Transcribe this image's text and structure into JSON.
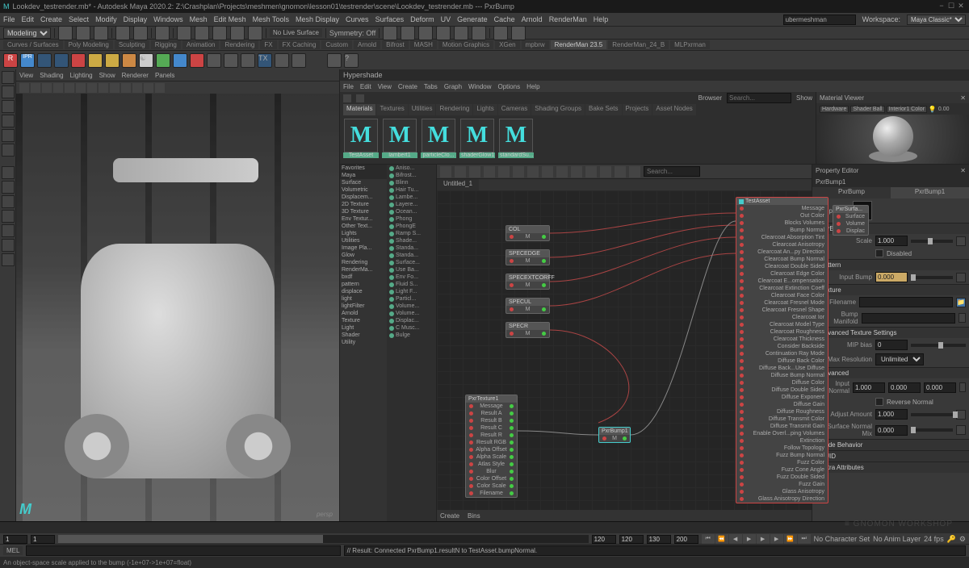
{
  "title": "Lookdev_testrender.mb* - Autodesk Maya 2020.2: Z:\\Crashplan\\Projects\\meshmen\\gnomon\\lesson01\\testrender\\scene\\Lookdev_testrender.mb --- PxrBump",
  "workspace_label": "Workspace:",
  "workspace_value": "Maya Classic*",
  "menus": [
    "File",
    "Edit",
    "Create",
    "Select",
    "Modify",
    "Display",
    "Windows",
    "Mesh",
    "Edit Mesh",
    "Mesh Tools",
    "Mesh Display",
    "Curves",
    "Surfaces",
    "Deform",
    "UV",
    "Generate",
    "Cache",
    "Arnold",
    "RenderMan",
    "Help"
  ],
  "sidebar_input": "ubermeshman",
  "shelf_mode": "Modeling",
  "shelf_nolive": "No Live Surface",
  "shelf_sym_label": "Symmetry: Off",
  "shelf_tabs": [
    "Curves / Surfaces",
    "Poly Modeling",
    "Sculpting",
    "Rigging",
    "Animation",
    "Rendering",
    "FX",
    "FX Caching",
    "Custom",
    "Arnold",
    "Bifrost",
    "MASH",
    "Motion Graphics",
    "XGen",
    "mpbrw",
    "RenderMan 23.5",
    "RenderMan_24_B",
    "MLPxrman"
  ],
  "viewport_menu": [
    "View",
    "Shading",
    "Lighting",
    "Show",
    "Renderer",
    "Panels"
  ],
  "viewport_label": "persp",
  "hypershade": {
    "title": "Hypershade",
    "menu": [
      "File",
      "Edit",
      "View",
      "Create",
      "Tabs",
      "Graph",
      "Window",
      "Options",
      "Help"
    ],
    "browser_label": "Browser",
    "show_label": "Show",
    "search_placeholder": "Search...",
    "tabs": [
      "Materials",
      "Textures",
      "Utilities",
      "Rendering",
      "Lights",
      "Cameras",
      "Shading Groups",
      "Bake Sets",
      "Projects",
      "Asset Nodes"
    ],
    "swatches": [
      {
        "letter": "M",
        "name": "TestAsset"
      },
      {
        "letter": "M",
        "name": "lambert1"
      },
      {
        "letter": "M",
        "name": "particleClo..."
      },
      {
        "letter": "M",
        "name": "shaderGlow1"
      },
      {
        "letter": "M",
        "name": "standardSu..."
      }
    ],
    "matviewer_title": "Material Viewer",
    "mv_hardware": "Hardware",
    "mv_shader": "Shader Ball",
    "mv_interior": "Interior1 Color",
    "create_title": "Create",
    "tree": [
      "Favorites",
      "Maya",
      "Surface",
      "Volumetric",
      "Displacem...",
      "2D Texture",
      "3D Texture",
      "Env Textur...",
      "Other Text...",
      "Lights",
      "Utilities",
      "Image Pla...",
      "Glow",
      "Rendering",
      "RenderMa...",
      "bxdf",
      "pattern",
      "displace",
      "light",
      "lightFilter",
      "Arnold",
      "Texture",
      "Light",
      "Shader",
      "Utility"
    ],
    "list": [
      "Aniso...",
      "Bifrost...",
      "Blinn",
      "Hair Tu...",
      "Lambe...",
      "Layere...",
      "Ocean...",
      "Phong",
      "PhongE",
      "Ramp S...",
      "Shade...",
      "Standa...",
      "Standa...",
      "Surface...",
      "Use Ba...",
      "Env Fo...",
      "Fluid S...",
      "Light F...",
      "Particl...",
      "Volume...",
      "Volume...",
      "Displac...",
      "C Musc...",
      "Bulge"
    ],
    "graph_tab": "Untitled_1",
    "graph_search": "Search...",
    "bins_label": "Bins"
  },
  "nodes": {
    "col": "COL",
    "specedge": "SPECEDGE",
    "specextcorff": "SPECEXTCORFF",
    "specul": "SPECUL",
    "specr": "SPECR",
    "pxrtex": "PxrTexture1",
    "pxrbump": "PxrBump1",
    "testasset": "TestAsset",
    "pxrsurf": "PxrSurfa...",
    "tex_rows": [
      "Message",
      "Result A",
      "Result B",
      "Result C",
      "Result R",
      "Result RGB",
      "Alpha Offset",
      "Alpha Scale",
      "Atlas Style",
      "Blur",
      "Color Offset",
      "Color Scale",
      "Filename"
    ],
    "asset_rows": [
      "Message",
      "Out Color",
      "Blocks Volumes",
      "Bump Normal",
      "Clearcoat Absorption Tint",
      "Clearcoat Anisotropy",
      "Clearcoat An...py Direction",
      "Clearcoat Bump Normal",
      "Clearcoat Double Sided",
      "Clearcoat Edge Color",
      "Clearcoat E...ompensation",
      "Clearcoat Extinction Coeff",
      "Clearcoat Face Color",
      "Clearcoat Fresnel Mode",
      "Clearcoat Fresnel Shape",
      "Clearcoat Ior",
      "Clearcoat Model Type",
      "Clearcoat Roughness",
      "Clearcoat Thickness",
      "Consider Backside",
      "Continuation Ray Mode",
      "Diffuse Back Color",
      "Diffuse Back...Use Diffuse",
      "Diffuse Bump Normal",
      "Diffuse Color",
      "Diffuse Double Sided",
      "Diffuse Exponent",
      "Diffuse Gain",
      "Diffuse Roughness",
      "Diffuse Transmit Color",
      "Diffuse Transmit Gain",
      "Enable Overl...ping Volumes",
      "Extinction",
      "Follow Topology",
      "Fuzz Bump Normal",
      "Fuzz Color",
      "Fuzz Cone Angle",
      "Fuzz Double Sided",
      "Fuzz Gain",
      "Glass Anisotropy",
      "Glass Anisotropy Direction"
    ],
    "surf_rows": [
      "Surface",
      "Volume",
      "Displac"
    ]
  },
  "props": {
    "title": "Property Editor",
    "node": "PxrBump1",
    "tabs": [
      "PxrBump",
      "PxrBump1"
    ],
    "sample_label": "Sample",
    "s_pxrbump": "PxrBump",
    "scale_label": "Scale",
    "scale_val": "1.000",
    "disabled": "Disabled",
    "s_pattern": "Pattern",
    "inputbump_label": "Input Bump",
    "inputbump_val": "0.000",
    "s_texture": "Texture",
    "filename_label": "Filename",
    "bumpmanifold_label": "Bump Manifold",
    "s_adv_tex": "Advanced Texture Settings",
    "mipbias_label": "MIP bias",
    "mipbias_val": "0",
    "maxres_label": "Max Resolution",
    "maxres_val": "Unlimited",
    "s_advanced": "Advanced",
    "inputnormal_label": "Input Normal",
    "inputnormal_x": "1.000",
    "inputnormal_y": "0.000",
    "inputnormal_z": "0.000",
    "reversenormal_label": "Reverse Normal",
    "adjustamount_label": "Adjust Amount",
    "adjustamount_val": "1.000",
    "surfacenormalmix_label": "Surface Normal Mix",
    "surfacenormalmix_val": "0.000",
    "s_nodebehavior": "Node Behavior",
    "s_uuid": "UUID",
    "s_extra": "Extra Attributes"
  },
  "timeline": {
    "start": "1",
    "current": "1",
    "end": "120",
    "range_end": "120",
    "nocharset": "No Character Set",
    "noanimlayer": "No Anim Layer",
    "fps": "24 fps",
    "rangevals": [
      "130",
      "200"
    ]
  },
  "cmd": {
    "label": "MEL",
    "result": "// Result: Connected PxrBump1.resultN to TestAsset.bumpNormal. "
  },
  "status": "An object-space scale applied to the bump (-1e+07->1e+07=float)",
  "watermark": "≡ GNOMON WORKSHOP"
}
